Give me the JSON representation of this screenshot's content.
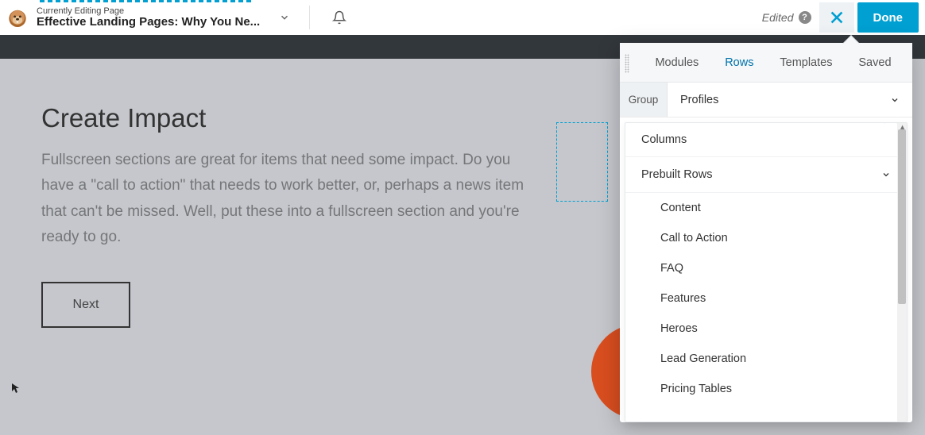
{
  "header": {
    "editing_label": "Currently Editing Page",
    "page_title": "Effective Landing Pages: Why You Ne...",
    "edited_label": "Edited",
    "done_label": "Done"
  },
  "canvas": {
    "hero_title": "Create Impact",
    "hero_body": "Fullscreen sections are great for items that need some impact. Do you have a \"call to action\" that needs to work better, or, perhaps a news item that can't be missed. Well, put these into a fullscreen section and you're ready to go.",
    "next_label": "Next"
  },
  "panel": {
    "tabs": {
      "modules": "Modules",
      "rows": "Rows",
      "templates": "Templates",
      "saved": "Saved"
    },
    "group_label": "Group",
    "select_value": "Profiles",
    "dropdown": {
      "columns": "Columns",
      "prebuilt": "Prebuilt Rows",
      "items": [
        "Content",
        "Call to Action",
        "FAQ",
        "Features",
        "Heroes",
        "Lead Generation",
        "Pricing Tables"
      ]
    }
  }
}
